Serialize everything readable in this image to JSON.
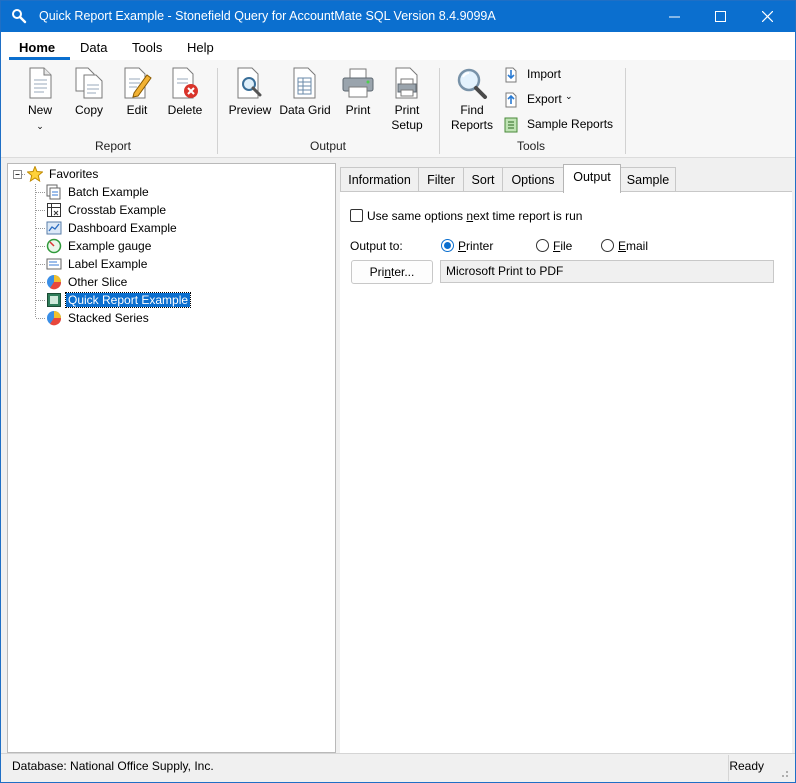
{
  "window": {
    "title": "Quick Report Example - Stonefield Query for AccountMate SQL Version 8.4.9099A"
  },
  "menu": {
    "tabs": [
      {
        "label": "Home",
        "active": true
      },
      {
        "label": "Data",
        "active": false
      },
      {
        "label": "Tools",
        "active": false
      },
      {
        "label": "Help",
        "active": false
      }
    ]
  },
  "ribbon": {
    "groups": [
      {
        "label": "Report",
        "buttons": [
          "New",
          "Copy",
          "Edit",
          "Delete"
        ]
      },
      {
        "label": "Output",
        "buttons": [
          "Preview",
          "Data Grid",
          "Print",
          "Print Setup"
        ]
      },
      {
        "label": "Tools",
        "buttons": [
          "Find Reports"
        ],
        "small_buttons": [
          "Import",
          "Export",
          "Sample Reports"
        ]
      }
    ],
    "new_label": "New",
    "copy_label": "Copy",
    "edit_label": "Edit",
    "delete_label": "Delete",
    "report_group": "Report",
    "preview_label": "Preview",
    "datagrid_label": "Data Grid",
    "print_label": "Print",
    "printsetup_line1": "Print",
    "printsetup_line2": "Setup",
    "output_group": "Output",
    "find_line1": "Find",
    "find_line2": "Reports",
    "import_label": "Import",
    "export_label": "Export",
    "sample_label": "Sample Reports",
    "tools_group": "Tools",
    "icons": [
      "new-document-icon",
      "copy-document-icon",
      "edit-document-icon",
      "delete-document-icon",
      "preview-icon",
      "data-grid-icon",
      "printer-icon",
      "print-setup-icon",
      "magnifier-icon",
      "import-icon",
      "export-icon",
      "sample-reports-icon"
    ]
  },
  "tree": {
    "root": "Favorites",
    "items": [
      {
        "label": "Batch Example",
        "icon": "batch-icon"
      },
      {
        "label": "Crosstab Example",
        "icon": "crosstab-icon"
      },
      {
        "label": "Dashboard Example",
        "icon": "dashboard-icon"
      },
      {
        "label": "Example gauge",
        "icon": "gauge-icon"
      },
      {
        "label": "Label Example",
        "icon": "label-icon"
      },
      {
        "label": "Other Slice",
        "icon": "pie-chart-icon"
      },
      {
        "label": "Quick Report Example",
        "icon": "quick-report-icon",
        "selected": true
      },
      {
        "label": "Stacked Series",
        "icon": "pie-chart-icon"
      }
    ]
  },
  "tabs": [
    {
      "label": "Information",
      "active": false
    },
    {
      "label": "Filter",
      "active": false
    },
    {
      "label": "Sort",
      "active": false
    },
    {
      "label": "Options",
      "active": false
    },
    {
      "label": "Output",
      "active": true
    },
    {
      "label": "Sample",
      "active": false
    }
  ],
  "output": {
    "same_options_pre": "Use same options ",
    "same_options_ul": "n",
    "same_options_post": "ext time report is run",
    "same_options_checked": false,
    "output_to_label": "Output to:",
    "radio_printer_ul": "P",
    "radio_printer_rest": "rinter",
    "radio_file_ul": "F",
    "radio_file_rest": "ile",
    "radio_email_ul": "E",
    "radio_email_rest": "mail",
    "selected": "Printer",
    "printer_btn_pre": "Pri",
    "printer_btn_ul": "n",
    "printer_btn_post": "ter...",
    "printer_value": "Microsoft Print to PDF"
  },
  "status": {
    "database": "Database: National Office Supply, Inc.",
    "state": "Ready"
  },
  "colors": {
    "accent": "#0b6fcf",
    "selection": "#0b6fcf"
  }
}
